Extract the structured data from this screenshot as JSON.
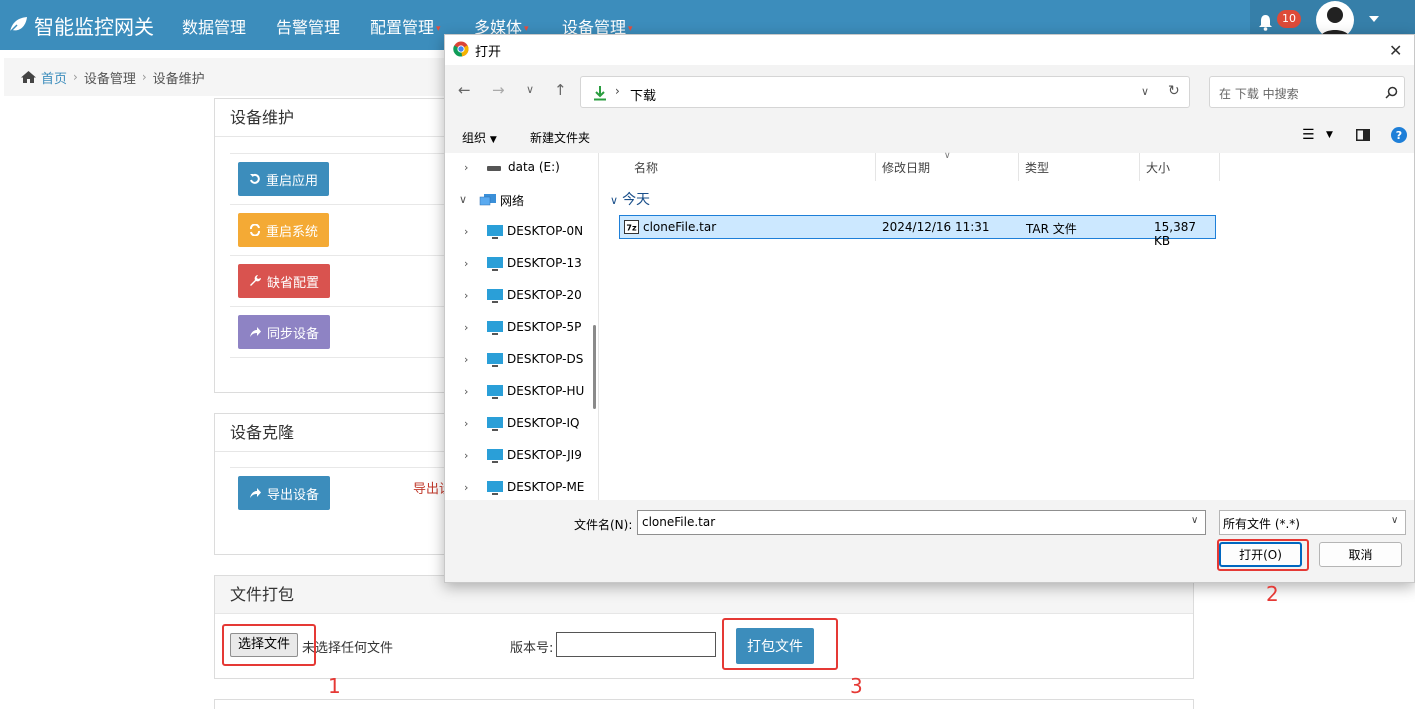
{
  "navbar": {
    "brand": "智能监控网关",
    "items": [
      "数据管理",
      "告警管理",
      "配置管理",
      "多媒体",
      "设备管理"
    ],
    "notification_count": "10"
  },
  "breadcrumb": [
    "首页",
    "设备管理",
    "设备维护"
  ],
  "maintenance": {
    "title": "设备维护",
    "buttons": [
      "重启应用",
      "重启系统",
      "缺省配置",
      "同步设备"
    ]
  },
  "clone": {
    "title": "设备克隆",
    "export_button": "导出设备",
    "note": "导出设"
  },
  "pack": {
    "title": "文件打包",
    "choose_file": "选择文件",
    "no_file": "未选择任何文件",
    "version_label": "版本号:",
    "version_value": "",
    "pack_button": "打包文件"
  },
  "callouts": [
    "1",
    "2",
    "3"
  ],
  "dialog": {
    "title": "打开",
    "path": "下载",
    "search_placeholder": "在 下载 中搜索",
    "toolbar": {
      "organize": "组织",
      "new_folder": "新建文件夹"
    },
    "tree": [
      {
        "label": "data (E:)"
      },
      {
        "label": "网络"
      },
      {
        "label": "DESKTOP-0N"
      },
      {
        "label": "DESKTOP-13"
      },
      {
        "label": "DESKTOP-20"
      },
      {
        "label": "DESKTOP-5P"
      },
      {
        "label": "DESKTOP-DS"
      },
      {
        "label": "DESKTOP-HU"
      },
      {
        "label": "DESKTOP-IQ"
      },
      {
        "label": "DESKTOP-JI9"
      },
      {
        "label": "DESKTOP-ME"
      }
    ],
    "columns": [
      "名称",
      "修改日期",
      "类型",
      "大小"
    ],
    "group": "今天",
    "files": [
      {
        "name": "cloneFile.tar",
        "date": "2024/12/16 11:31",
        "type": "TAR 文件",
        "size": "15,387 KB"
      }
    ],
    "filename_label": "文件名(N):",
    "filename_value": "cloneFile.tar",
    "filetype": "所有文件 (*.*)",
    "open_button": "打开(O)",
    "cancel_button": "取消"
  },
  "colors": {
    "navbar": "#3c8dbc",
    "callout": "#e53935",
    "selection": "#cce8ff"
  }
}
